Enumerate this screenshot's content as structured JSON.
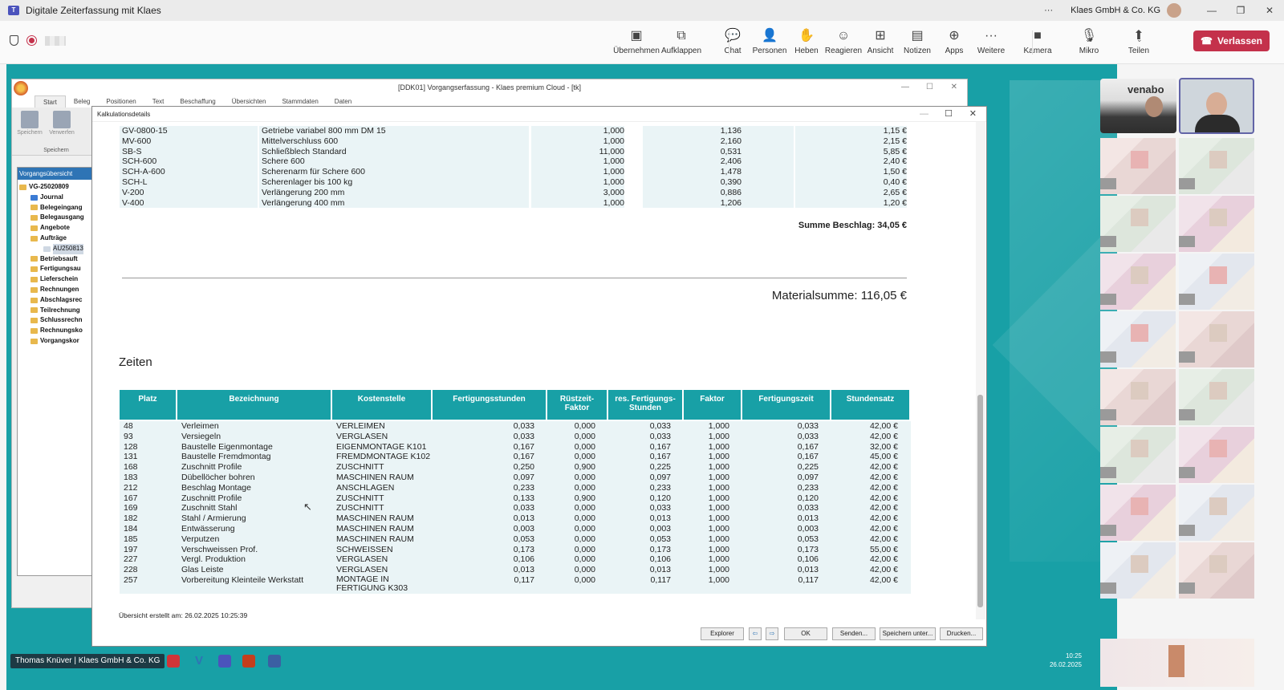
{
  "window": {
    "title": "Digitale Zeiterfassung mit Klaes",
    "more": "···",
    "org": "Klaes GmbH & Co. KG",
    "min": "—",
    "max": "❐",
    "close": "✕"
  },
  "toolbar": {
    "items": [
      {
        "label": "Übernehmen",
        "icon": "▣"
      },
      {
        "label": "Aufklappen",
        "icon": "⧉"
      },
      {
        "label": "Chat",
        "icon": "💬"
      },
      {
        "label": "Personen",
        "icon": "👤"
      },
      {
        "label": "Heben",
        "icon": "✋"
      },
      {
        "label": "Reagieren",
        "icon": "☺"
      },
      {
        "label": "Ansicht",
        "icon": "⊞"
      },
      {
        "label": "Notizen",
        "icon": "▤"
      },
      {
        "label": "Apps",
        "icon": "⊕"
      },
      {
        "label": "Weitere",
        "icon": "···"
      },
      {
        "label": "Kamera",
        "icon": "■"
      },
      {
        "label": "Mikro",
        "icon": "🎙"
      },
      {
        "label": "Teilen",
        "icon": "⬆"
      }
    ],
    "leave_label": "Verlassen",
    "leave_icon": "☎"
  },
  "app": {
    "title": "[DDK01] Vorgangserfassung - Klaes premium Cloud - [tk]",
    "menu": [
      "Start",
      "Beleg",
      "Positionen",
      "Text",
      "Beschaffung",
      "Übersichten",
      "Stammdaten",
      "Daten"
    ],
    "ribbon": {
      "save": "Speichern",
      "discard": "Verwerfen",
      "group": "Speichern"
    },
    "tree_header": "Vorgangsübersicht",
    "tree": [
      "VG-25020809",
      "Journal",
      "Belegeingang",
      "Belegausgang",
      "Angebote",
      "Aufträge",
      "AU250813",
      "Betriebsauft",
      "Fertigungsau",
      "Lieferschein",
      "Rechnungen",
      "Abschlagsrec",
      "Teilrechnung",
      "Schlussrechn",
      "Rechnungsko",
      "Vorgangskor"
    ]
  },
  "dialog": {
    "title": "Kalkulationsdetails",
    "material_rows": [
      [
        "GV-0800-15",
        "Getriebe variabel 800 mm DM 15",
        "1,000",
        "1,136",
        "1,15 €"
      ],
      [
        "MV-600",
        "Mittelverschluss 600",
        "1,000",
        "2,160",
        "2,15 €"
      ],
      [
        "SB-S",
        "Schließblech Standard",
        "11,000",
        "0,531",
        "5,85 €"
      ],
      [
        "SCH-600",
        "Schere 600",
        "1,000",
        "2,406",
        "2,40 €"
      ],
      [
        "SCH-A-600",
        "Scherenarm für Schere 600",
        "1,000",
        "1,478",
        "1,50 €"
      ],
      [
        "SCH-L",
        "Scherenlager bis 100 kg",
        "1,000",
        "0,390",
        "0,40 €"
      ],
      [
        "V-200",
        "Verlängerung 200 mm",
        "3,000",
        "0,886",
        "2,65 €"
      ],
      [
        "V-400",
        "Verlängerung 400 mm",
        "1,000",
        "1,206",
        "1,20 €"
      ]
    ],
    "summe_beschlag": "Summe Beschlag: 34,05 €",
    "materialsumme": "Materialsumme: 116,05 €",
    "zeiten_title": "Zeiten",
    "headers": [
      "Platz",
      "Bezeichnung",
      "Kostenstelle",
      "Fertigungsstunden",
      "Rüstzeit-\nFaktor",
      "res. Fertigungs-\nStunden",
      "Faktor",
      "Fertigungszeit",
      "Stundensatz"
    ],
    "zeiten_rows": [
      [
        "48",
        "Verleimen",
        "VERLEIMEN",
        "0,033",
        "0,000",
        "0,033",
        "1,000",
        "0,033",
        "42,00 €"
      ],
      [
        "93",
        "Versiegeln",
        "VERGLASEN",
        "0,033",
        "0,000",
        "0,033",
        "1,000",
        "0,033",
        "42,00 €"
      ],
      [
        "128",
        "Baustelle Eigenmontage",
        "EIGENMONTAGE K101",
        "0,167",
        "0,000",
        "0,167",
        "1,000",
        "0,167",
        "32,00 €"
      ],
      [
        "131",
        "Baustelle Fremdmontag",
        "FREMDMONTAGE K102",
        "0,167",
        "0,000",
        "0,167",
        "1,000",
        "0,167",
        "45,00 €"
      ],
      [
        "168",
        "Zuschnitt Profile",
        "ZUSCHNITT",
        "0,250",
        "0,900",
        "0,225",
        "1,000",
        "0,225",
        "42,00 €"
      ],
      [
        "183",
        "Dübellöcher bohren",
        "MASCHINEN RAUM",
        "0,097",
        "0,000",
        "0,097",
        "1,000",
        "0,097",
        "42,00 €"
      ],
      [
        "212",
        "Beschlag Montage",
        "ANSCHLAGEN",
        "0,233",
        "0,000",
        "0,233",
        "1,000",
        "0,233",
        "42,00 €"
      ],
      [
        "167",
        "Zuschnitt Profile",
        "ZUSCHNITT",
        "0,133",
        "0,900",
        "0,120",
        "1,000",
        "0,120",
        "42,00 €"
      ],
      [
        "169",
        "Zuschnitt Stahl",
        "ZUSCHNITT",
        "0,033",
        "0,000",
        "0,033",
        "1,000",
        "0,033",
        "42,00 €"
      ],
      [
        "182",
        "Stahl / Armierung",
        "MASCHINEN RAUM",
        "0,013",
        "0,000",
        "0,013",
        "1,000",
        "0,013",
        "42,00 €"
      ],
      [
        "184",
        "Entwässerung",
        "MASCHINEN RAUM",
        "0,003",
        "0,000",
        "0,003",
        "1,000",
        "0,003",
        "42,00 €"
      ],
      [
        "185",
        "Verputzen",
        "MASCHINEN RAUM",
        "0,053",
        "0,000",
        "0,053",
        "1,000",
        "0,053",
        "42,00 €"
      ],
      [
        "197",
        "Verschweissen Prof.",
        "SCHWEISSEN",
        "0,173",
        "0,000",
        "0,173",
        "1,000",
        "0,173",
        "55,00 €"
      ],
      [
        "227",
        "Vergl. Produktion",
        "VERGLASEN",
        "0,106",
        "0,000",
        "0,106",
        "1,000",
        "0,106",
        "42,00 €"
      ],
      [
        "228",
        "Glas Leiste",
        "VERGLASEN",
        "0,013",
        "0,000",
        "0,013",
        "1,000",
        "0,013",
        "42,00 €"
      ],
      [
        "257",
        "Vorbereitung Kleinteile Werkstatt",
        "MONTAGE IN FERTIGUNG K303",
        "0,117",
        "0,000",
        "0,117",
        "1,000",
        "0,117",
        "42,00 €"
      ]
    ],
    "footer": "Übersicht erstellt am: 26.02.2025 10:25:39",
    "buttons": {
      "explorer": "Explorer",
      "prev": "⇦",
      "next": "⇨",
      "ok": "OK",
      "senden": "Senden...",
      "speichern": "Speichern unter...",
      "drucken": "Drucken..."
    }
  },
  "taskbar": {
    "user": "Thomas Knüver | Klaes GmbH & Co. KG",
    "time": "10:25",
    "date": "26.02.2025"
  },
  "participants": {
    "brand_text": "venabo"
  },
  "colors": {
    "teal": "#18a0a6",
    "leave_red": "#c4314b"
  }
}
